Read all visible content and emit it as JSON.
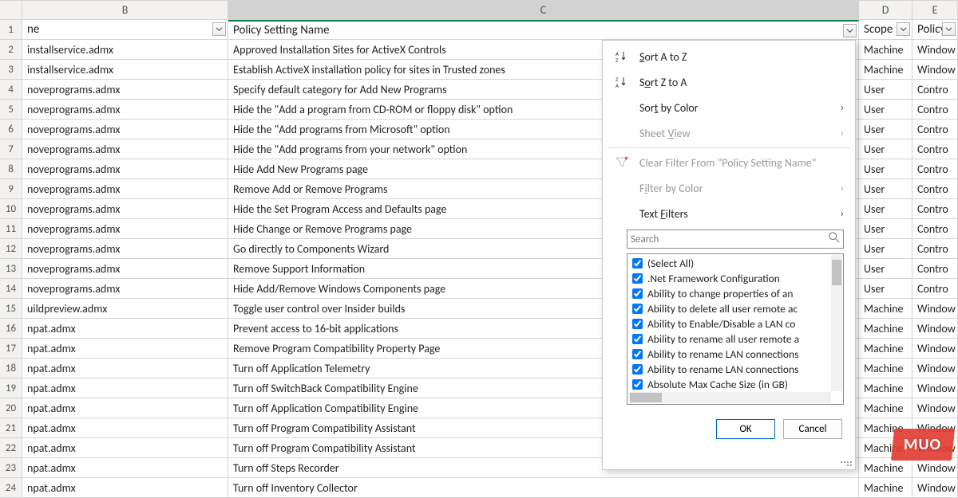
{
  "columns": {
    "rownum": "",
    "B": {
      "letter": "B",
      "header": "ne"
    },
    "C": {
      "letter": "C",
      "header": "Policy Setting Name"
    },
    "D": {
      "letter": "D",
      "header": "Scope"
    },
    "E": {
      "letter": "E",
      "header": "Policy I"
    }
  },
  "rows": [
    {
      "n": "1",
      "B": "ne",
      "C": "Policy Setting Name",
      "D": "Scope",
      "E": "Policy I"
    },
    {
      "n": "2",
      "B": "installservice.admx",
      "C": "Approved Installation Sites for ActiveX Controls",
      "D": "Machine",
      "E": "Window"
    },
    {
      "n": "3",
      "B": "installservice.admx",
      "C": "Establish ActiveX installation policy for sites in Trusted zones",
      "D": "Machine",
      "E": "Window"
    },
    {
      "n": "4",
      "B": "noveprograms.admx",
      "C": "Specify default category for Add New Programs",
      "D": "User",
      "E": "Contro"
    },
    {
      "n": "5",
      "B": "noveprograms.admx",
      "C": "Hide the \"Add a program from CD-ROM or floppy disk\" option",
      "D": "User",
      "E": "Contro"
    },
    {
      "n": "6",
      "B": "noveprograms.admx",
      "C": "Hide the \"Add programs from Microsoft\" option",
      "D": "User",
      "E": "Contro"
    },
    {
      "n": "7",
      "B": "noveprograms.admx",
      "C": "Hide the \"Add programs from your network\" option",
      "D": "User",
      "E": "Contro"
    },
    {
      "n": "8",
      "B": "noveprograms.admx",
      "C": "Hide Add New Programs page",
      "D": "User",
      "E": "Contro"
    },
    {
      "n": "9",
      "B": "noveprograms.admx",
      "C": "Remove Add or Remove Programs",
      "D": "User",
      "E": "Contro"
    },
    {
      "n": "10",
      "B": "noveprograms.admx",
      "C": "Hide the Set Program Access and Defaults page",
      "D": "User",
      "E": "Contro"
    },
    {
      "n": "11",
      "B": "noveprograms.admx",
      "C": "Hide Change or Remove Programs page",
      "D": "User",
      "E": "Contro"
    },
    {
      "n": "12",
      "B": "noveprograms.admx",
      "C": "Go directly to Components Wizard",
      "D": "User",
      "E": "Contro"
    },
    {
      "n": "13",
      "B": "noveprograms.admx",
      "C": "Remove Support Information",
      "D": "User",
      "E": "Contro"
    },
    {
      "n": "14",
      "B": "noveprograms.admx",
      "C": "Hide Add/Remove Windows Components page",
      "D": "User",
      "E": "Contro"
    },
    {
      "n": "15",
      "B": "uildpreview.admx",
      "C": "Toggle user control over Insider builds",
      "D": "Machine",
      "E": "Window"
    },
    {
      "n": "16",
      "B": "npat.admx",
      "C": "Prevent access to 16-bit applications",
      "D": "Machine",
      "E": "Window"
    },
    {
      "n": "17",
      "B": "npat.admx",
      "C": "Remove Program Compatibility Property Page",
      "D": "Machine",
      "E": "Window"
    },
    {
      "n": "18",
      "B": "npat.admx",
      "C": "Turn off Application Telemetry",
      "D": "Machine",
      "E": "Window"
    },
    {
      "n": "19",
      "B": "npat.admx",
      "C": "Turn off SwitchBack Compatibility Engine",
      "D": "Machine",
      "E": "Window"
    },
    {
      "n": "20",
      "B": "npat.admx",
      "C": "Turn off Application Compatibility Engine",
      "D": "Machine",
      "E": "Window"
    },
    {
      "n": "21",
      "B": "npat.admx",
      "C": "Turn off Program Compatibility Assistant",
      "D": "Machine",
      "E": "Window"
    },
    {
      "n": "22",
      "B": "npat.admx",
      "C": "Turn off Program Compatibility Assistant",
      "D": "Machine",
      "E": "Window"
    },
    {
      "n": "23",
      "B": "npat.admx",
      "C": "Turn off Steps Recorder",
      "D": "Machine",
      "E": "Window"
    },
    {
      "n": "24",
      "B": "npat.admx",
      "C": "Turn off Inventory Collector",
      "D": "Machine",
      "E": "Window"
    }
  ],
  "dropdown": {
    "sort_az": "Sort A to Z",
    "sort_za": "Sort Z to A",
    "sort_color": "Sort by Color",
    "sheet_view": "Sheet View",
    "clear_filter": "Clear Filter From \"Policy Setting Name\"",
    "filter_color": "Filter by Color",
    "text_filters": "Text Filters",
    "search_placeholder": "Search",
    "items": [
      "(Select All)",
      ".Net Framework Configuration",
      "Ability to change properties of an",
      "Ability to delete all user remote ac",
      "Ability to Enable/Disable a LAN co",
      "Ability to rename all user remote a",
      "Ability to rename LAN connections",
      "Ability to rename LAN connections",
      "Absolute Max Cache Size (in GB)"
    ],
    "ok": "OK",
    "cancel": "Cancel"
  },
  "watermark": "MUO"
}
